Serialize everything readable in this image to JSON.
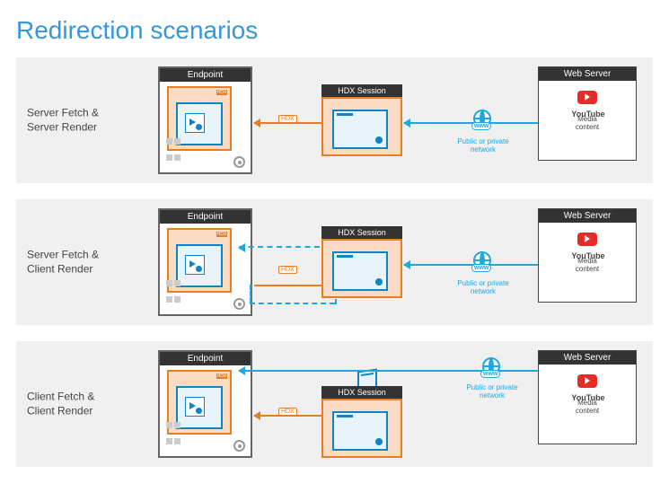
{
  "title": "Redirection scenarios",
  "labels": {
    "endpoint": "Endpoint",
    "hdx_session": "HDX Session",
    "web_server": "Web Server",
    "hdx_tag": "HDX",
    "www": "www",
    "network": "Public or private network",
    "media": "Media content",
    "youtube": "YouTube"
  },
  "scenarios": [
    {
      "id": "sfsr",
      "label": "Server Fetch & Server Render"
    },
    {
      "id": "sfcr",
      "label": "Server Fetch & Client Render"
    },
    {
      "id": "cfcr",
      "label": "Client Fetch & Client Render"
    }
  ]
}
